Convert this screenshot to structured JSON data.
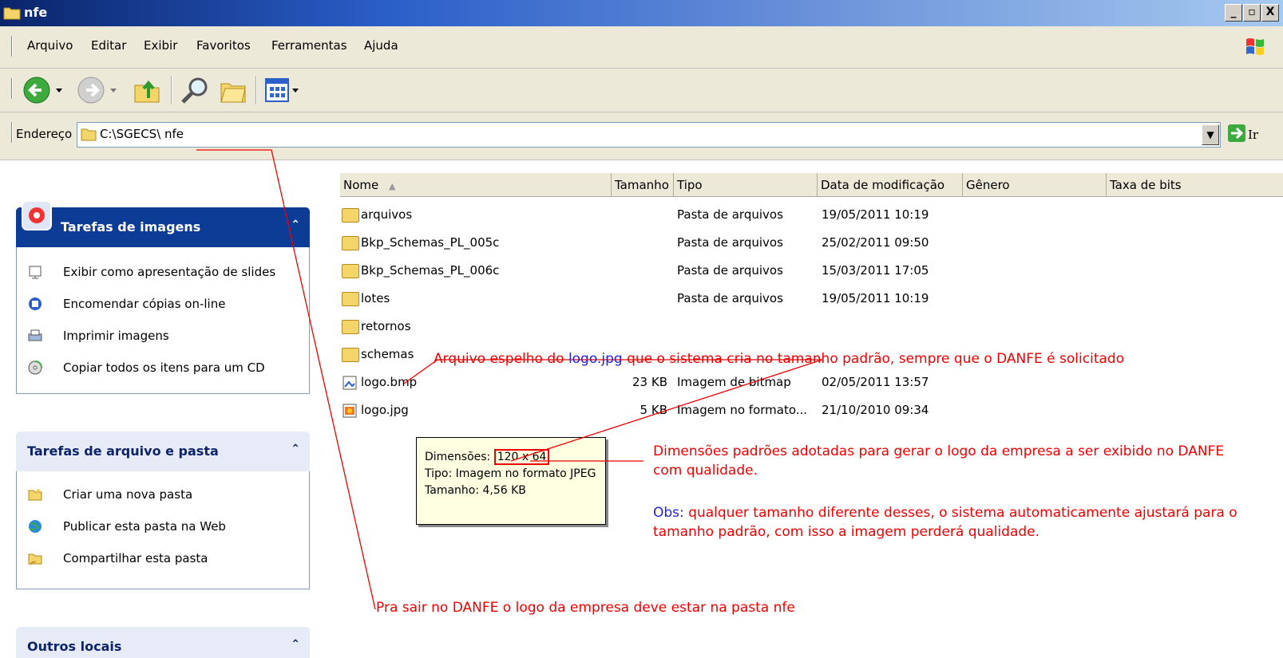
{
  "window": {
    "title": "nfe",
    "minimize": "_",
    "maximize": "▫",
    "close": "X"
  },
  "menu": [
    "Arquivo",
    "Editar",
    "Exibir",
    "Favoritos",
    "Ferramentas",
    "Ajuda"
  ],
  "address": {
    "label": "Endereço",
    "value": "C:\\SGECS\\ nfe",
    "go": "Ir"
  },
  "sidebar": {
    "image_tasks": {
      "title": "Tarefas de imagens",
      "items": [
        "Exibir como apresentação de slides",
        "Encomendar cópias on-line",
        "Imprimir imagens",
        "Copiar todos os itens para um CD"
      ]
    },
    "file_tasks": {
      "title": "Tarefas de arquivo e pasta",
      "items": [
        "Criar uma nova pasta",
        "Publicar esta pasta na Web",
        "Compartilhar esta pasta"
      ]
    },
    "other": {
      "title": "Outros locais"
    },
    "chevron": "⌃"
  },
  "columns": [
    "Nome",
    "Tamanho",
    "Tipo",
    "Data de modificação",
    "Gênero",
    "Taxa de bits"
  ],
  "sort_indicator": "▲",
  "files": [
    {
      "name": "arquivos",
      "size": "",
      "type": "Pasta de arquivos",
      "date": "19/05/2011 10:19",
      "icon": "folder-icon"
    },
    {
      "name": "Bkp_Schemas_PL_005c",
      "size": "",
      "type": "Pasta de arquivos",
      "date": "25/02/2011 09:50",
      "icon": "folder-icon"
    },
    {
      "name": "Bkp_Schemas_PL_006c",
      "size": "",
      "type": "Pasta de arquivos",
      "date": "15/03/2011 17:05",
      "icon": "folder-icon"
    },
    {
      "name": "lotes",
      "size": "",
      "type": "Pasta de arquivos",
      "date": "19/05/2011 10:19",
      "icon": "folder-icon"
    },
    {
      "name": "retornos",
      "size": "",
      "type": "",
      "date": "",
      "icon": "folder-icon"
    },
    {
      "name": "schemas",
      "size": "",
      "type": "",
      "date": "",
      "icon": "folder-icon"
    },
    {
      "name": "logo.bmp",
      "size": "23 KB",
      "type": "Imagem de bitmap",
      "date": "02/05/2011 13:57",
      "icon": "bitmap-icon"
    },
    {
      "name": "logo.jpg",
      "size": "5 KB",
      "type": "Imagem no formato...",
      "date": "21/10/2010 09:34",
      "icon": "jpeg-icon"
    }
  ],
  "tooltip": {
    "dim_label": "Dimensões:",
    "dim_value": "120 x 64",
    "type_line": "Tipo: Imagem no formato JPEG",
    "size_line": "Tamanho: 4,56 KB"
  },
  "annotations": {
    "mirror_a": "Arquivo espelho do ",
    "mirror_b": "logo.jpg",
    "mirror_c": " que o sistema cria no tamanho padrão, sempre que o DANFE é solicitado",
    "dim_1": "Dimensões padrões adotadas para gerar o logo da empresa a ser exibido no DANFE",
    "dim_2": "com qualidade.",
    "obs_label": "Obs:",
    "obs_1": " qualquer tamanho diferente desses, o sistema automaticamente ajustará para o",
    "obs_2": "tamanho padrão, com isso a imagem perderá qualidade.",
    "folder_note": "Pra sair no DANFE o logo da empresa deve estar na pasta nfe"
  },
  "colors": {
    "annotation": "#e00000",
    "link": "#2222dd",
    "title_start": "#0a246a",
    "panel_blue": "#0c3c96"
  }
}
